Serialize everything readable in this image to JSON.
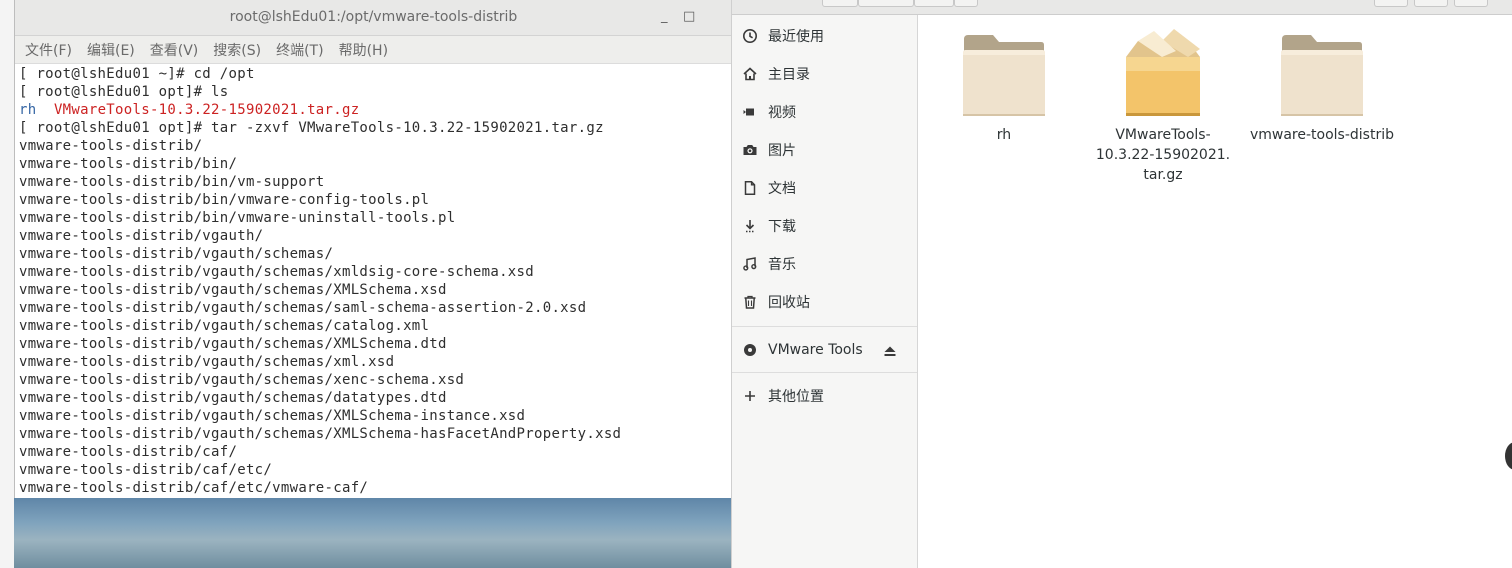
{
  "terminal": {
    "title": "root@lshEdu01:/opt/vmware-tools-distrib",
    "controls": {
      "minimize": "_",
      "maximize": "□"
    },
    "menu": [
      "文件(F)",
      "编辑(E)",
      "查看(V)",
      "搜索(S)",
      "终端(T)",
      "帮助(H)"
    ],
    "lines": [
      "[ root@lshEdu01 ~]# cd /opt",
      "[ root@lshEdu01 opt]# ls",
      "",
      "[ root@lshEdu01 opt]# tar -zxvf VMwareTools-10.3.22-15902021.tar.gz",
      "vmware-tools-distrib/",
      "vmware-tools-distrib/bin/",
      "vmware-tools-distrib/bin/vm-support",
      "vmware-tools-distrib/bin/vmware-config-tools.pl",
      "vmware-tools-distrib/bin/vmware-uninstall-tools.pl",
      "vmware-tools-distrib/vgauth/",
      "vmware-tools-distrib/vgauth/schemas/",
      "vmware-tools-distrib/vgauth/schemas/xmldsig-core-schema.xsd",
      "vmware-tools-distrib/vgauth/schemas/XMLSchema.xsd",
      "vmware-tools-distrib/vgauth/schemas/saml-schema-assertion-2.0.xsd",
      "vmware-tools-distrib/vgauth/schemas/catalog.xml",
      "vmware-tools-distrib/vgauth/schemas/XMLSchema.dtd",
      "vmware-tools-distrib/vgauth/schemas/xml.xsd",
      "vmware-tools-distrib/vgauth/schemas/xenc-schema.xsd",
      "vmware-tools-distrib/vgauth/schemas/datatypes.dtd",
      "vmware-tools-distrib/vgauth/schemas/XMLSchema-instance.xsd",
      "vmware-tools-distrib/vgauth/schemas/XMLSchema-hasFacetAndProperty.xsd",
      "vmware-tools-distrib/caf/",
      "vmware-tools-distrib/caf/etc/",
      "vmware-tools-distrib/caf/etc/vmware-caf/"
    ],
    "ls_output": {
      "dir": "rh",
      "file": "VMwareTools-10.3.22-15902021.tar.gz"
    },
    "colors": {
      "directory": "#3465a4",
      "archive": "#cc2222",
      "text": "#2e2e2e"
    }
  },
  "file_manager": {
    "sidebar": {
      "places": [
        {
          "label": "最近使用",
          "icon": "clock-icon"
        },
        {
          "label": "主目录",
          "icon": "home-icon"
        },
        {
          "label": "视频",
          "icon": "video-icon"
        },
        {
          "label": "图片",
          "icon": "camera-icon"
        },
        {
          "label": "文档",
          "icon": "document-icon"
        },
        {
          "label": "下载",
          "icon": "download-icon"
        },
        {
          "label": "音乐",
          "icon": "music-icon"
        },
        {
          "label": "回收站",
          "icon": "trash-icon"
        }
      ],
      "devices": [
        {
          "label": "VMware Tools",
          "icon": "disc-icon",
          "action_icon": "eject-icon"
        }
      ],
      "other": {
        "label": "其他位置",
        "icon": "plus-icon"
      }
    },
    "files": [
      {
        "name": "rh",
        "type": "folder",
        "icon": "folder-icon"
      },
      {
        "name": "VMwareTools-10.3.22-15902021.tar.gz",
        "name_lines": [
          "VMwareTools-",
          "10.3.22-15902021.",
          "tar.gz"
        ],
        "type": "archive",
        "icon": "package-icon"
      },
      {
        "name": "vmware-tools-distrib",
        "type": "folder",
        "icon": "folder-icon"
      }
    ]
  }
}
